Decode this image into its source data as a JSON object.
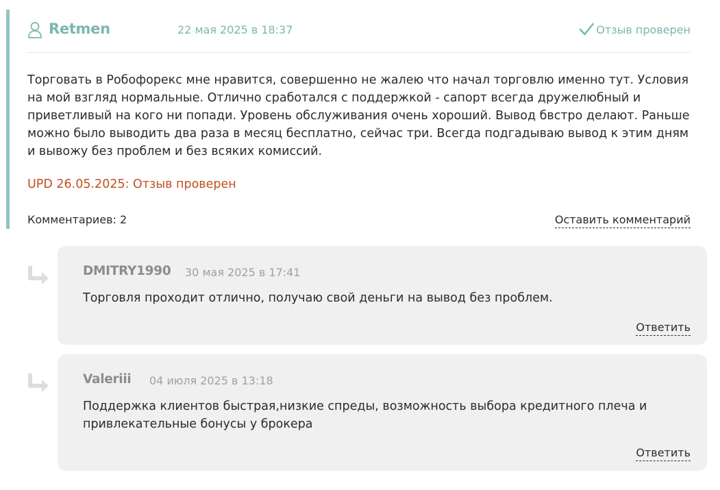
{
  "review": {
    "author": "Retmen",
    "date": "22 мая 2025 в 18:37",
    "verified_label": "Отзыв проверен",
    "body": "Торговать в Робофорекс мне нравится, совершенно не жалею что начал торговлю именно тут. Условия на мой взгляд нормальные. Отлично сработался с поддержкой - сапорт всегда дружелюбный и приветливый на кого ни попади. Уровень обслуживания очень хороший. Вывод бвстро делают. Раньше можно было выводить два раза в месяц бесплатно, сейчас три. Всегда подгадываю вывод к этим дням и вывожу без проблем и без всяких комиссий.",
    "update_note": "UPD 26.05.2025: Отзыв проверен",
    "comments_count": "Комментариев: 2",
    "leave_comment_label": "Оставить комментарий",
    "icons": {
      "user": "user-icon",
      "verified": "checkmark-icon"
    },
    "colors": {
      "accent": "#7bb7b0",
      "accent_bar": "#8fc6bd",
      "update": "#c0501d",
      "reply_background": "#f0f0f0"
    }
  },
  "replies": [
    {
      "author": "DMITRY1990",
      "date": "30 мая 2025 в 17:41",
      "text": "Торговля проходит отлично, получаю свой деньги на вывод без проблем.",
      "reply_label": "Ответить",
      "icon": "reply-arrow-icon"
    },
    {
      "author": "Valeriii",
      "date": "04 июля 2025 в 13:18",
      "text": "Поддержка клиентов быстрая,низкие спреды, возможность выбора кредитного плеча и привлекательные бонусы у брокера",
      "reply_label": "Ответить",
      "icon": "reply-arrow-icon"
    }
  ]
}
